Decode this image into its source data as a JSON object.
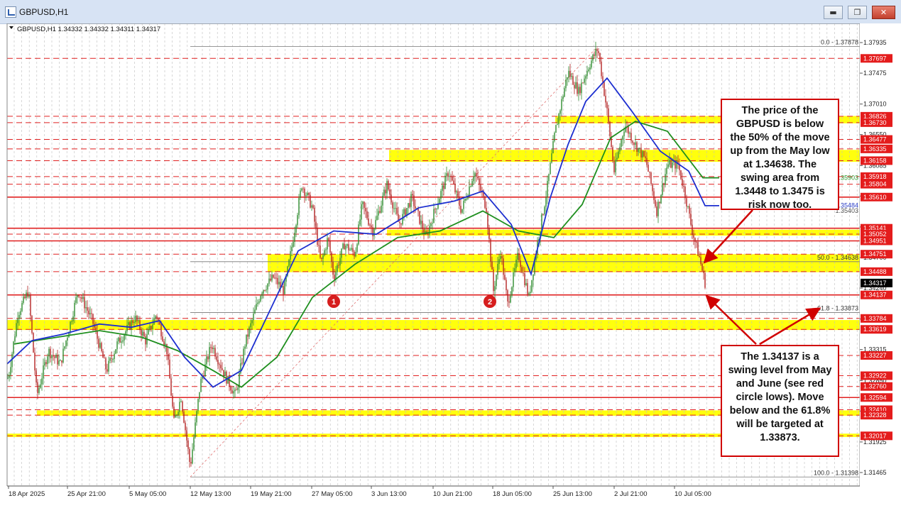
{
  "window": {
    "title": "GBPUSD,H1",
    "buttons": {
      "minimize": "▬",
      "maximize": "❐",
      "close": "✕"
    }
  },
  "chart_data": {
    "type": "candlestick",
    "symbol_info": "GBPUSD,H1  1.34332 1.34332 1.34311 1.34317",
    "ylim": [
      1.312,
      1.3805
    ],
    "x_ticks": [
      "18 Apr 2025",
      "25 Apr 21:00",
      "5 May 05:00",
      "12 May 13:00",
      "19 May 21:00",
      "27 May 05:00",
      "3 Jun 13:00",
      "10 Jun 21:00",
      "18 Jun 05:00",
      "25 Jun 13:00",
      "2 Jul 21:00",
      "10 Jul 05:00"
    ],
    "y_ticks": [
      "1.37935",
      "1.37475",
      "1.37010",
      "1.36550",
      "1.36085",
      "1.35625",
      "1.35160",
      "1.34700",
      "1.34240",
      "1.33775",
      "1.33315",
      "1.32850",
      "1.32390",
      "1.31925",
      "1.31465"
    ],
    "current_price": "1.34317",
    "red_levels": [
      "1.37697",
      "1.36826",
      "1.36730",
      "1.36477",
      "1.36335",
      "1.36158",
      "1.35918",
      "1.35804",
      "1.35610",
      "1.35141",
      "1.35052",
      "1.34951",
      "1.34751",
      "1.34488",
      "1.34137",
      "1.33784",
      "1.33619",
      "1.33227",
      "1.32922",
      "1.32760",
      "1.32594",
      "1.32410",
      "1.32328",
      "1.32017"
    ],
    "line_tags": [
      {
        "label": "1.35903",
        "value": 1.35903,
        "color": "#2f9a2f"
      },
      {
        "label": "1.35484",
        "value": 1.35484,
        "color": "#2b3fc8"
      },
      {
        "label": "1.35403",
        "value": 1.35403,
        "color": "#555555"
      }
    ],
    "fib_levels": [
      {
        "label": "0.0 - 1.37878",
        "value": 1.37878
      },
      {
        "label": "50.0 - 1.34638",
        "value": 1.34638
      },
      {
        "label": "61.8 - 1.33873",
        "value": 1.33873
      },
      {
        "label": "100.0 - 1.31398",
        "value": 1.31398
      }
    ],
    "yellow_zones": [
      [
        1.3672,
        1.3683
      ],
      [
        1.3614,
        1.3632
      ],
      [
        1.3503,
        1.3512
      ],
      [
        1.3448,
        1.3475
      ],
      [
        1.3361,
        1.3376
      ],
      [
        1.3232,
        1.324
      ],
      [
        1.32,
        1.3205
      ]
    ],
    "circle_labels": [
      "1",
      "2"
    ],
    "price_path": [
      [
        0,
        1.328
      ],
      [
        12,
        1.329
      ],
      [
        25,
        1.3385
      ],
      [
        40,
        1.342
      ],
      [
        52,
        1.3262
      ],
      [
        68,
        1.333
      ],
      [
        85,
        1.331
      ],
      [
        110,
        1.342
      ],
      [
        130,
        1.3375
      ],
      [
        150,
        1.33
      ],
      [
        165,
        1.334
      ],
      [
        190,
        1.338
      ],
      [
        205,
        1.3345
      ],
      [
        220,
        1.3385
      ],
      [
        235,
        1.333
      ],
      [
        245,
        1.3222
      ],
      [
        255,
        1.326
      ],
      [
        268,
        1.3155
      ],
      [
        282,
        1.328
      ],
      [
        298,
        1.334
      ],
      [
        318,
        1.329
      ],
      [
        332,
        1.3262
      ],
      [
        345,
        1.334
      ],
      [
        368,
        1.342
      ],
      [
        385,
        1.344
      ],
      [
        400,
        1.342
      ],
      [
        410,
        1.348
      ],
      [
        425,
        1.358
      ],
      [
        440,
        1.3545
      ],
      [
        452,
        1.346
      ],
      [
        462,
        1.35
      ],
      [
        470,
        1.344
      ],
      [
        485,
        1.349
      ],
      [
        500,
        1.3475
      ],
      [
        510,
        1.355
      ],
      [
        525,
        1.351
      ],
      [
        545,
        1.358
      ],
      [
        562,
        1.352
      ],
      [
        580,
        1.356
      ],
      [
        600,
        1.35
      ],
      [
        615,
        1.355
      ],
      [
        632,
        1.36
      ],
      [
        650,
        1.354
      ],
      [
        668,
        1.36
      ],
      [
        685,
        1.3545
      ],
      [
        695,
        1.342
      ],
      [
        705,
        1.348
      ],
      [
        715,
        1.34
      ],
      [
        730,
        1.3475
      ],
      [
        745,
        1.341
      ],
      [
        755,
        1.348
      ],
      [
        770,
        1.357
      ],
      [
        782,
        1.366
      ],
      [
        800,
        1.375
      ],
      [
        815,
        1.372
      ],
      [
        830,
        1.376
      ],
      [
        842,
        1.3785
      ],
      [
        855,
        1.369
      ],
      [
        865,
        1.36
      ],
      [
        880,
        1.367
      ],
      [
        895,
        1.364
      ],
      [
        910,
        1.3615
      ],
      [
        925,
        1.354
      ],
      [
        940,
        1.361
      ],
      [
        955,
        1.361
      ],
      [
        965,
        1.3565
      ],
      [
        975,
        1.351
      ],
      [
        985,
        1.347
      ],
      [
        993,
        1.3432
      ]
    ],
    "ma_blue": [
      [
        10,
        1.331
      ],
      [
        45,
        1.3345
      ],
      [
        90,
        1.3355
      ],
      [
        140,
        1.337
      ],
      [
        185,
        1.3365
      ],
      [
        225,
        1.3375
      ],
      [
        260,
        1.332
      ],
      [
        300,
        1.3275
      ],
      [
        340,
        1.33
      ],
      [
        380,
        1.339
      ],
      [
        420,
        1.348
      ],
      [
        470,
        1.351
      ],
      [
        530,
        1.3505
      ],
      [
        590,
        1.3545
      ],
      [
        640,
        1.3555
      ],
      [
        680,
        1.357
      ],
      [
        720,
        1.352
      ],
      [
        748,
        1.3445
      ],
      [
        775,
        1.356
      ],
      [
        800,
        1.364
      ],
      [
        825,
        1.3705
      ],
      [
        855,
        1.374
      ],
      [
        890,
        1.369
      ],
      [
        930,
        1.363
      ],
      [
        970,
        1.36
      ],
      [
        993,
        1.3548
      ],
      [
        1013,
        1.3548
      ]
    ],
    "ma_green": [
      [
        20,
        1.334
      ],
      [
        80,
        1.335
      ],
      [
        140,
        1.336
      ],
      [
        200,
        1.335
      ],
      [
        250,
        1.333
      ],
      [
        300,
        1.33
      ],
      [
        340,
        1.3275
      ],
      [
        390,
        1.332
      ],
      [
        440,
        1.341
      ],
      [
        500,
        1.346
      ],
      [
        560,
        1.35
      ],
      [
        620,
        1.351
      ],
      [
        680,
        1.354
      ],
      [
        730,
        1.351
      ],
      [
        780,
        1.35
      ],
      [
        820,
        1.355
      ],
      [
        860,
        1.365
      ],
      [
        895,
        1.3675
      ],
      [
        940,
        1.366
      ],
      [
        990,
        1.359
      ],
      [
        1013,
        1.359
      ]
    ],
    "fib_diagonal": [
      [
        268,
        1.31398
      ],
      [
        842,
        1.37878
      ]
    ]
  },
  "annotations": {
    "note_top": "The price of the GBPUSD is below the 50% of the move up from the May low at 1.34638.  The swing area from 1.3448 to 1.3475 is risk now too.",
    "note_bottom": "The 1.34137 is a swing level from May and June (see red circle lows).  Move below and the 61.8% will be targeted at 1.33873."
  },
  "colors": {
    "up": "#2e8b2e",
    "down": "#b32222",
    "level_red": "#e02020",
    "zone_yellow": "#ffff00",
    "blue_ma": "#1d2fd0",
    "green_ma": "#1f8f1f",
    "arrow": "#d00000"
  }
}
